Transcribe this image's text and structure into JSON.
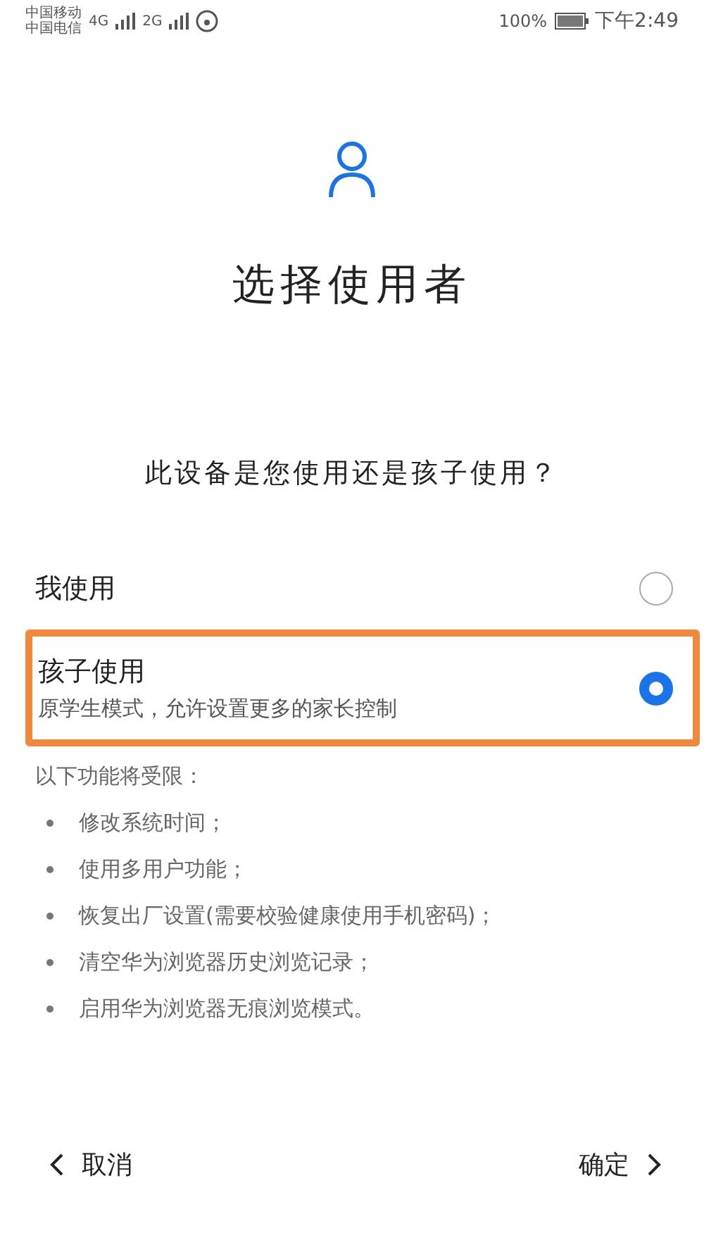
{
  "status_bar": {
    "carriers": [
      "中国移动",
      "中国电信"
    ],
    "networks": [
      "4G",
      "2G"
    ],
    "battery": "100%",
    "time": "下午2:49"
  },
  "title": "选择使用者",
  "question": "此设备是您使用还是孩子使用？",
  "options": [
    {
      "label": "我使用",
      "selected": false,
      "highlighted": false
    },
    {
      "label": "孩子使用",
      "description": "原学生模式，允许设置更多的家长控制",
      "selected": true,
      "highlighted": true
    }
  ],
  "restrictions": {
    "heading": "以下功能将受限：",
    "items": [
      "修改系统时间；",
      "使用多用户功能；",
      "恢复出厂设置(需要校验健康使用手机密码)；",
      "清空华为浏览器历史浏览记录；",
      "启用华为浏览器无痕浏览模式。"
    ]
  },
  "footer": {
    "cancel": "取消",
    "confirm": "确定"
  }
}
